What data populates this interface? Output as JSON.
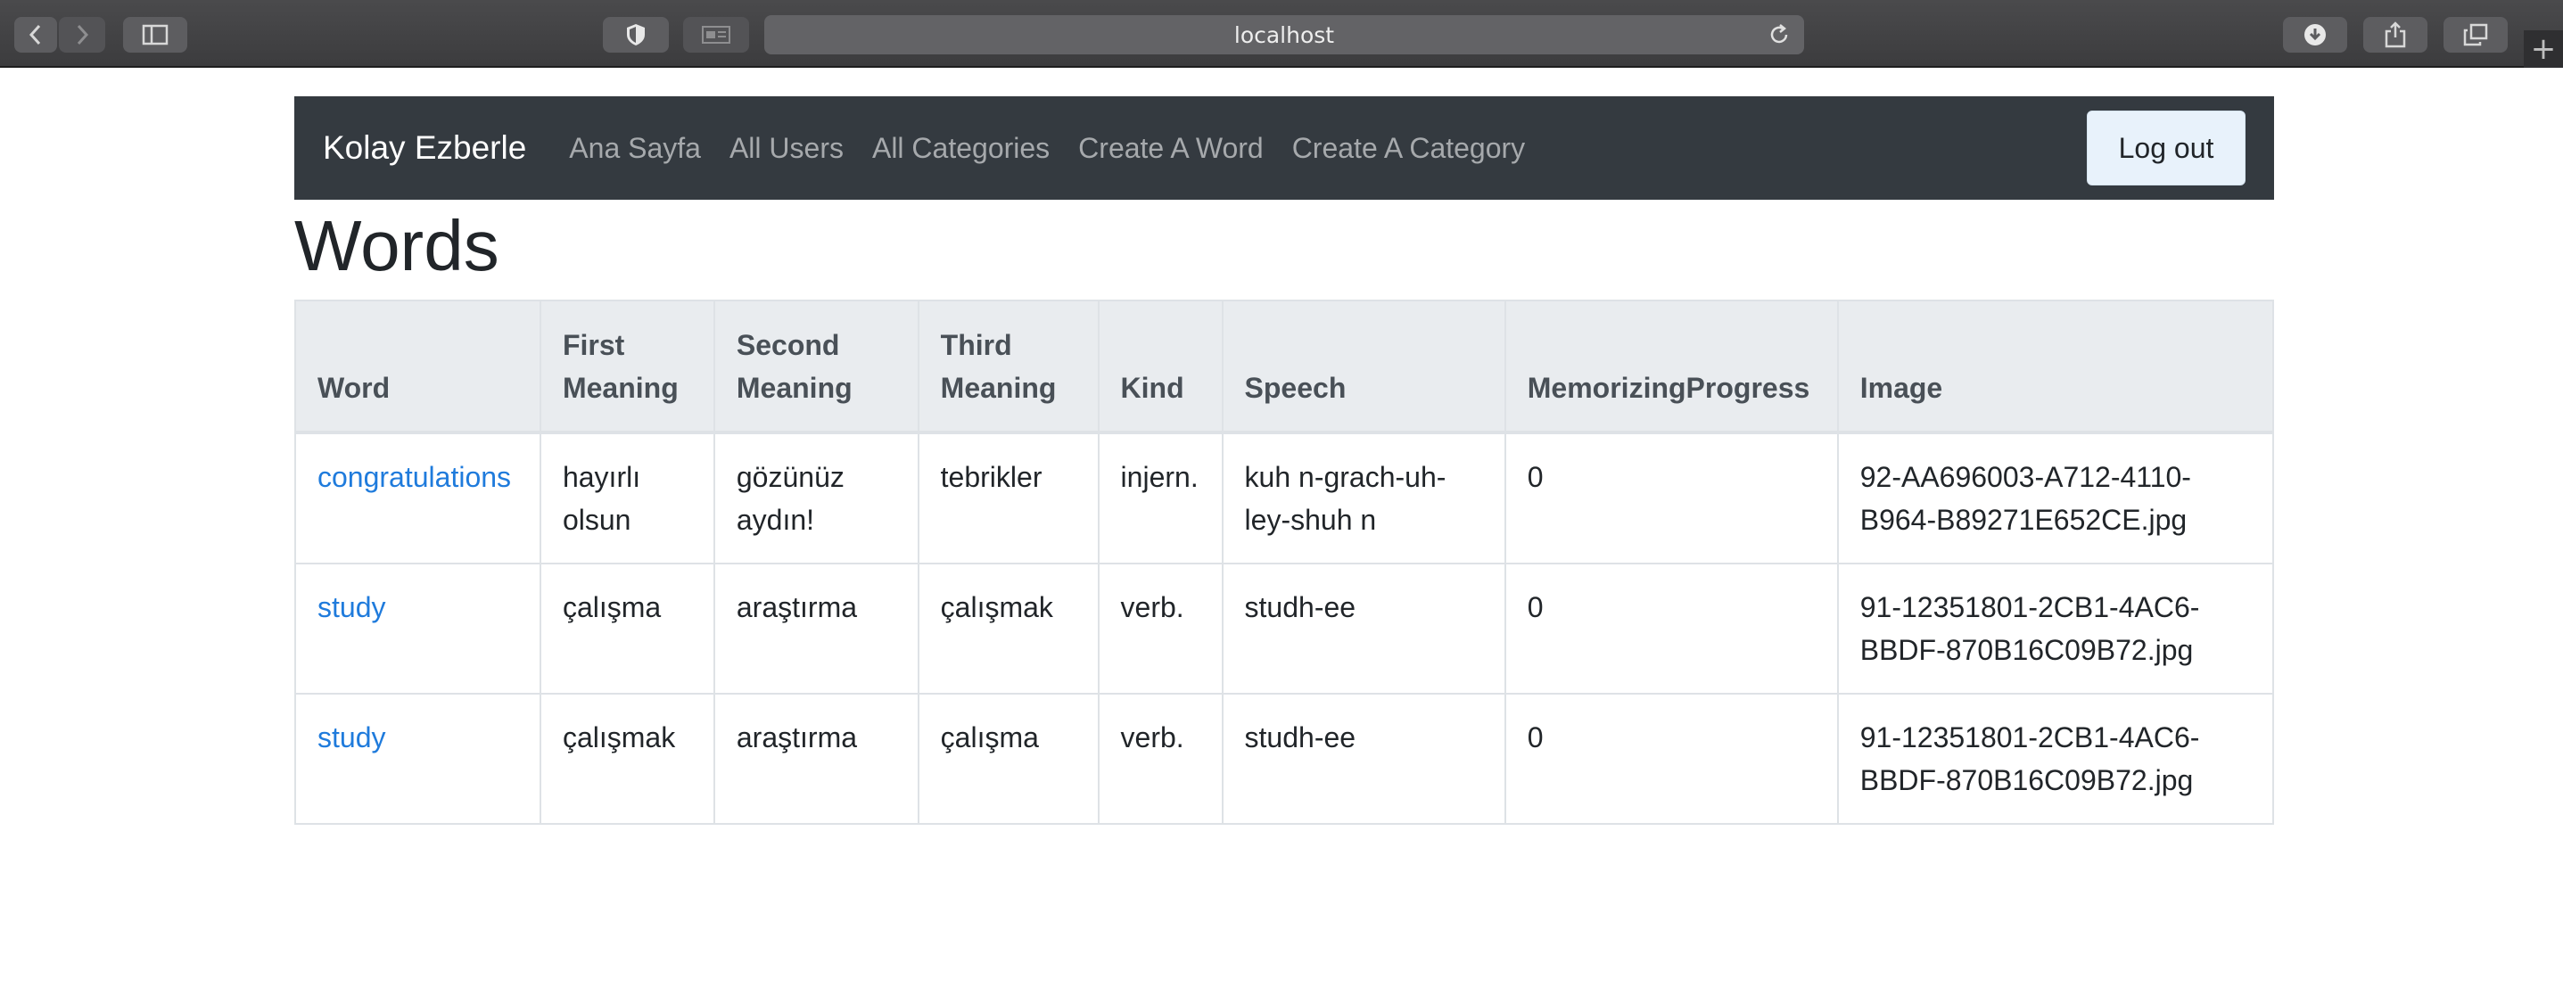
{
  "browser": {
    "url": "localhost",
    "icons": [
      "back-icon",
      "forward-icon",
      "sidebar-icon",
      "privacy-icon",
      "reader-icon",
      "reload-icon",
      "download-icon",
      "share-icon",
      "tabs-icon",
      "new-tab-icon"
    ]
  },
  "navbar": {
    "brand": "Kolay Ezberle",
    "links": [
      "Ana Sayfa",
      "All Users",
      "All Categories",
      "Create A Word",
      "Create A Category"
    ],
    "logout": "Log out"
  },
  "page": {
    "title": "Words"
  },
  "table": {
    "headers": [
      "Word",
      "First Meaning",
      "Second Meaning",
      "Third Meaning",
      "Kind",
      "Speech",
      "MemorizingProgress",
      "Image"
    ],
    "rows": [
      [
        "congratulations",
        "hayırlı olsun",
        "gözünüz aydın!",
        "tebrikler",
        "injern.",
        "kuh n-grach-uh-ley-shuh n",
        "0",
        "92-AA696003-A712-4110-B964-B89271E652CE.jpg"
      ],
      [
        "study",
        "çalışma",
        "araştırma",
        "çalışmak",
        "verb.",
        "studh-ee",
        "0",
        "91-12351801-2CB1-4AC6-BBDF-870B16C09B72.jpg"
      ],
      [
        "study",
        "çalışmak",
        "araştırma",
        "çalışma",
        "verb.",
        "studh-ee",
        "0",
        "91-12351801-2CB1-4AC6-BBDF-870B16C09B72.jpg"
      ]
    ]
  },
  "colors": {
    "navbar_bg": "#343a40",
    "link": "#1f7bdc",
    "header_bg": "#e9ecef"
  }
}
